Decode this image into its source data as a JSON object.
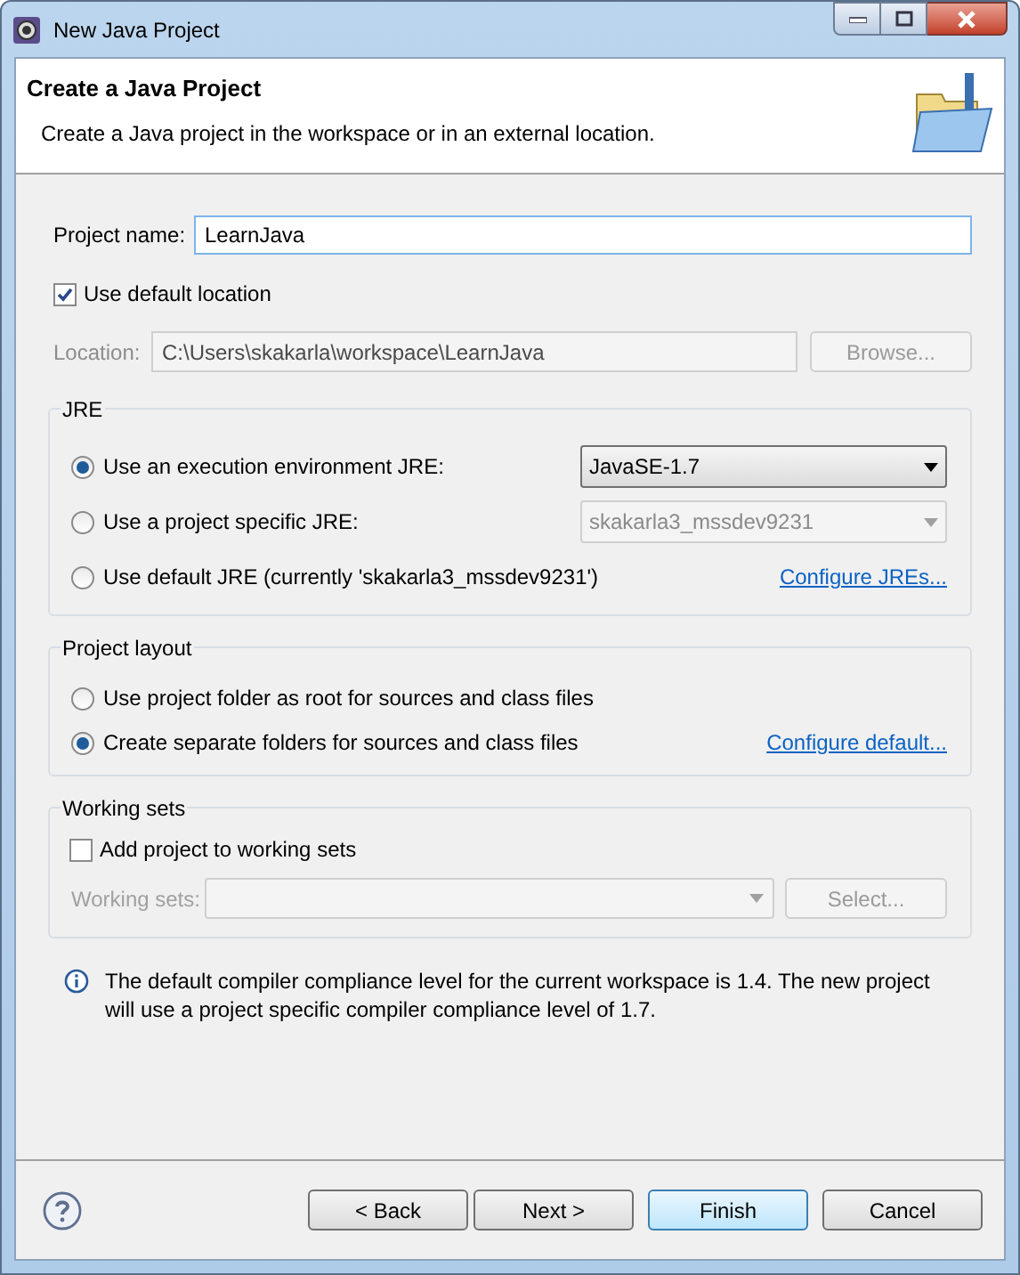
{
  "window": {
    "title": "New Java Project"
  },
  "header": {
    "title": "Create a Java Project",
    "description": "Create a Java project in the workspace or in an external location."
  },
  "project_name": {
    "label": "Project name:",
    "value": "LearnJava"
  },
  "default_location": {
    "label": "Use default location",
    "checked": true
  },
  "location": {
    "label": "Location:",
    "value": "C:\\Users\\skakarla\\workspace\\LearnJava",
    "disabled": true,
    "button": "Browse..."
  },
  "jre": {
    "title": "JRE",
    "options": [
      {
        "label": "Use an execution environment JRE:",
        "selected": true,
        "combo": {
          "value": "JavaSE-1.7",
          "disabled": false
        }
      },
      {
        "label": "Use a project specific JRE:",
        "selected": false,
        "combo": {
          "value": "skakarla3_mssdev9231",
          "disabled": true
        }
      },
      {
        "label": "Use default JRE (currently 'skakarla3_mssdev9231')",
        "selected": false,
        "link": "Configure JREs..."
      }
    ]
  },
  "project_layout": {
    "title": "Project layout",
    "options": [
      {
        "label": "Use project folder as root for sources and class files",
        "selected": false
      },
      {
        "label": "Create separate folders for sources and class files",
        "selected": true,
        "link": "Configure default..."
      }
    ]
  },
  "working_sets": {
    "title": "Working sets",
    "add": {
      "label": "Add project to working sets",
      "checked": false
    },
    "field": {
      "label": "Working sets:",
      "disabled": true
    },
    "button": "Select..."
  },
  "info": "The default compiler compliance level for the current workspace is 1.4. The new project will use a project specific compiler compliance level of 1.7.",
  "buttons": [
    {
      "label": "< Back",
      "default": false
    },
    {
      "label": "Next >",
      "default": false
    },
    {
      "label": "Finish",
      "default": true
    },
    {
      "label": "Cancel",
      "default": false
    }
  ]
}
